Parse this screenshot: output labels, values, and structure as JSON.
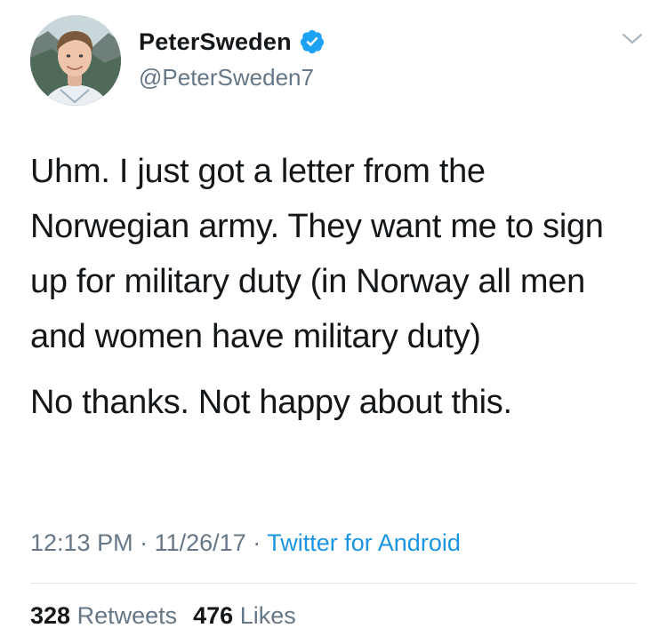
{
  "author": {
    "display_name": "PeterSweden",
    "handle": "@PeterSweden7",
    "verified": true
  },
  "tweet": {
    "paragraphs": [
      "Uhm. I just got a letter from the Norwegian army. They want me to sign up for military duty (in Norway all men and women have military duty)",
      "No thanks. Not happy about this."
    ],
    "time": "12:13 PM",
    "date": "11/26/17",
    "separator": "·",
    "source": "Twitter for Android"
  },
  "stats": {
    "retweets_count": "328",
    "retweets_label": "Retweets",
    "likes_count": "476",
    "likes_label": "Likes"
  },
  "colors": {
    "text": "#14171a",
    "secondary": "#657786",
    "link": "#1b95e0",
    "verified": "#1da1f2",
    "divider": "#e1e8ed"
  },
  "icons": {
    "verified": "verified-badge-icon",
    "menu": "chevron-down-icon"
  }
}
